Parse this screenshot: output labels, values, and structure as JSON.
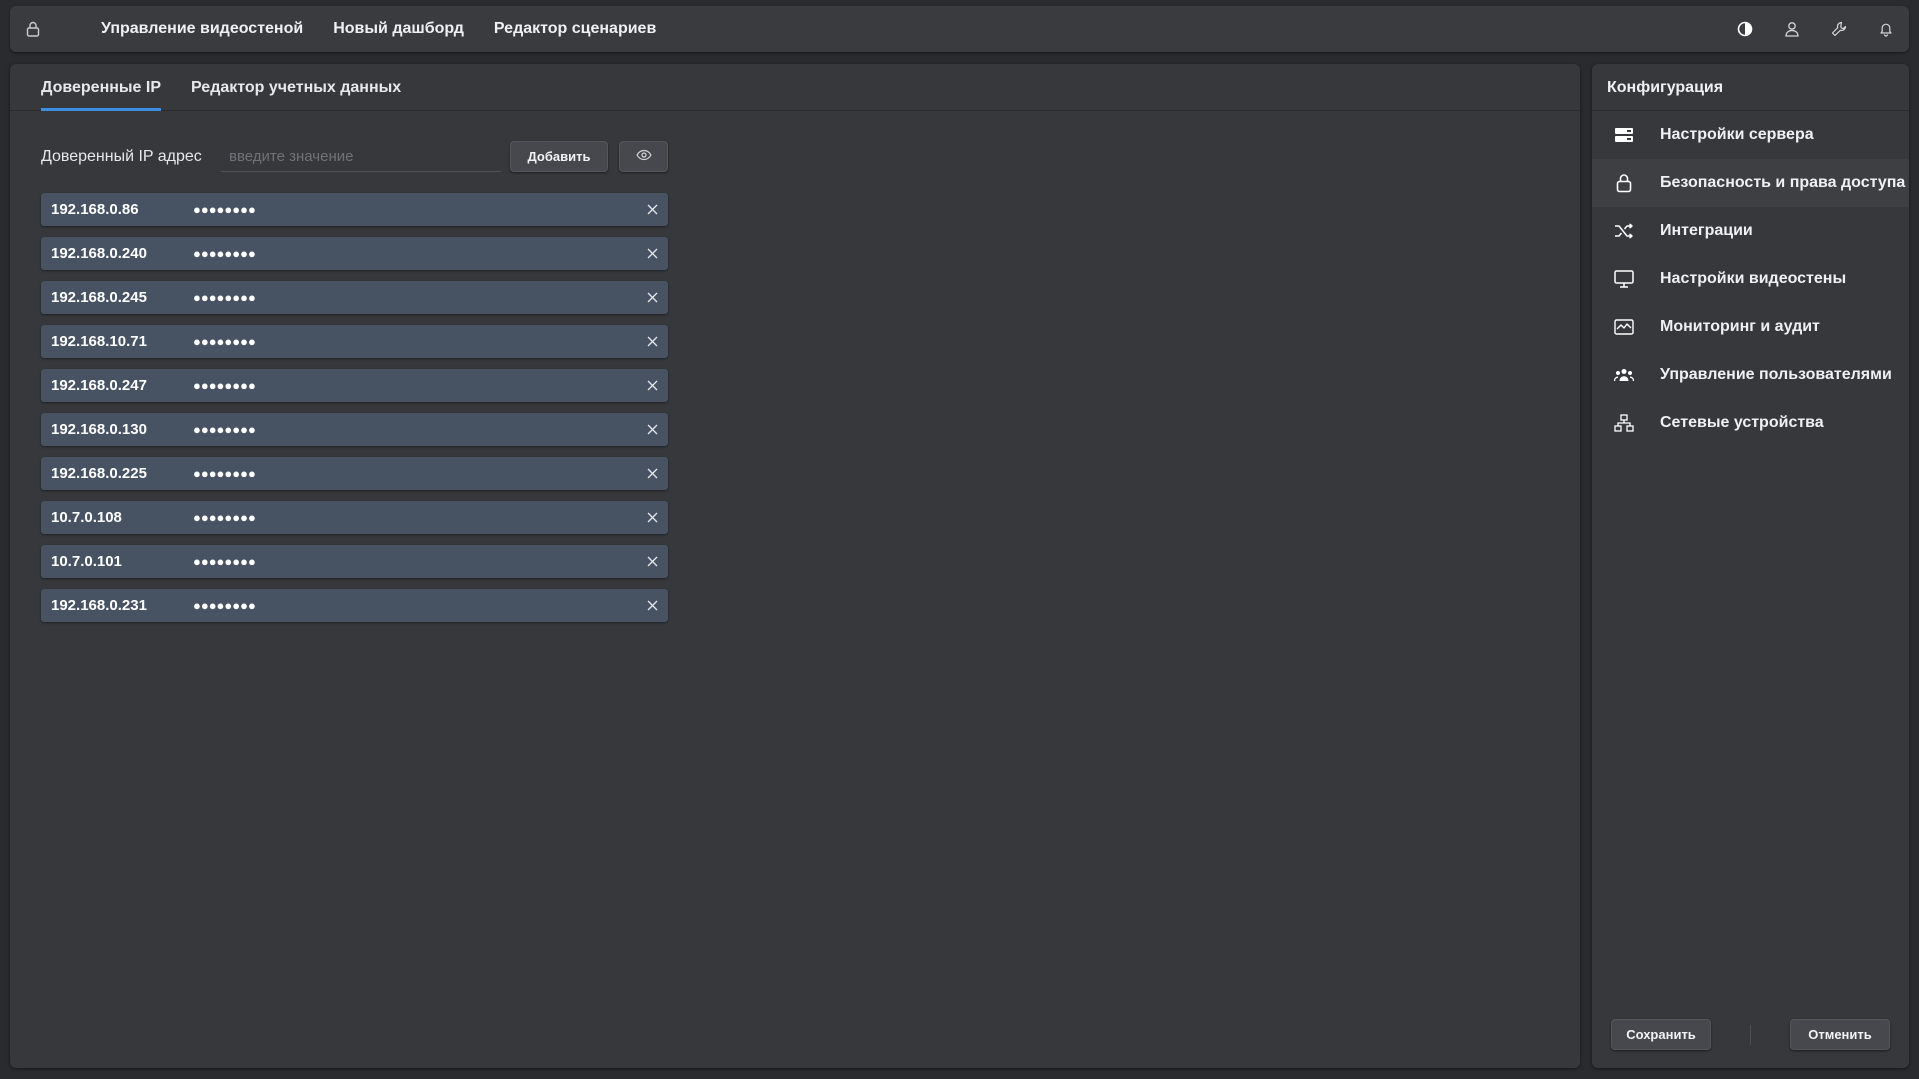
{
  "topbar": {
    "nav": [
      {
        "label": "Управление видеостеной"
      },
      {
        "label": "Новый дашборд"
      },
      {
        "label": "Редактор сценариев"
      }
    ],
    "icons": [
      "lock-icon",
      "contrast-icon",
      "user-icon",
      "wrench-icon",
      "bell-icon"
    ]
  },
  "tabs": [
    {
      "label": "Доверенные IP",
      "active": true
    },
    {
      "label": "Редактор учетных данных",
      "active": false
    }
  ],
  "form": {
    "label": "Доверенный IP адрес",
    "placeholder": "введите значение",
    "value": "",
    "add_label": "Добавить"
  },
  "ip_list": [
    {
      "ip": "192.168.0.86",
      "secret": "●●●●●●●●"
    },
    {
      "ip": "192.168.0.240",
      "secret": "●●●●●●●●"
    },
    {
      "ip": "192.168.0.245",
      "secret": "●●●●●●●●"
    },
    {
      "ip": "192.168.10.71",
      "secret": "●●●●●●●●"
    },
    {
      "ip": "192.168.0.247",
      "secret": "●●●●●●●●"
    },
    {
      "ip": "192.168.0.130",
      "secret": "●●●●●●●●"
    },
    {
      "ip": "192.168.0.225",
      "secret": "●●●●●●●●"
    },
    {
      "ip": "10.7.0.108",
      "secret": "●●●●●●●●"
    },
    {
      "ip": "10.7.0.101",
      "secret": "●●●●●●●●"
    },
    {
      "ip": "192.168.0.231",
      "secret": "●●●●●●●●"
    }
  ],
  "sidebar": {
    "title": "Конфигурация",
    "items": [
      {
        "label": "Настройки сервера",
        "icon": "server-icon"
      },
      {
        "label": "Безопасность и права доступа",
        "icon": "lock-icon",
        "active": true
      },
      {
        "label": "Интеграции",
        "icon": "shuffle-icon"
      },
      {
        "label": "Настройки видеостены",
        "icon": "monitor-icon"
      },
      {
        "label": "Мониторинг и аудит",
        "icon": "activity-icon"
      },
      {
        "label": "Управление пользователями",
        "icon": "users-icon"
      },
      {
        "label": "Сетевые устройства",
        "icon": "network-icon"
      }
    ],
    "save_label": "Сохранить",
    "cancel_label": "Отменить"
  },
  "colors": {
    "background": "#2a2b2e",
    "panel": "#37383b",
    "accent": "#3d8fe0",
    "ip_row": "#475263"
  }
}
